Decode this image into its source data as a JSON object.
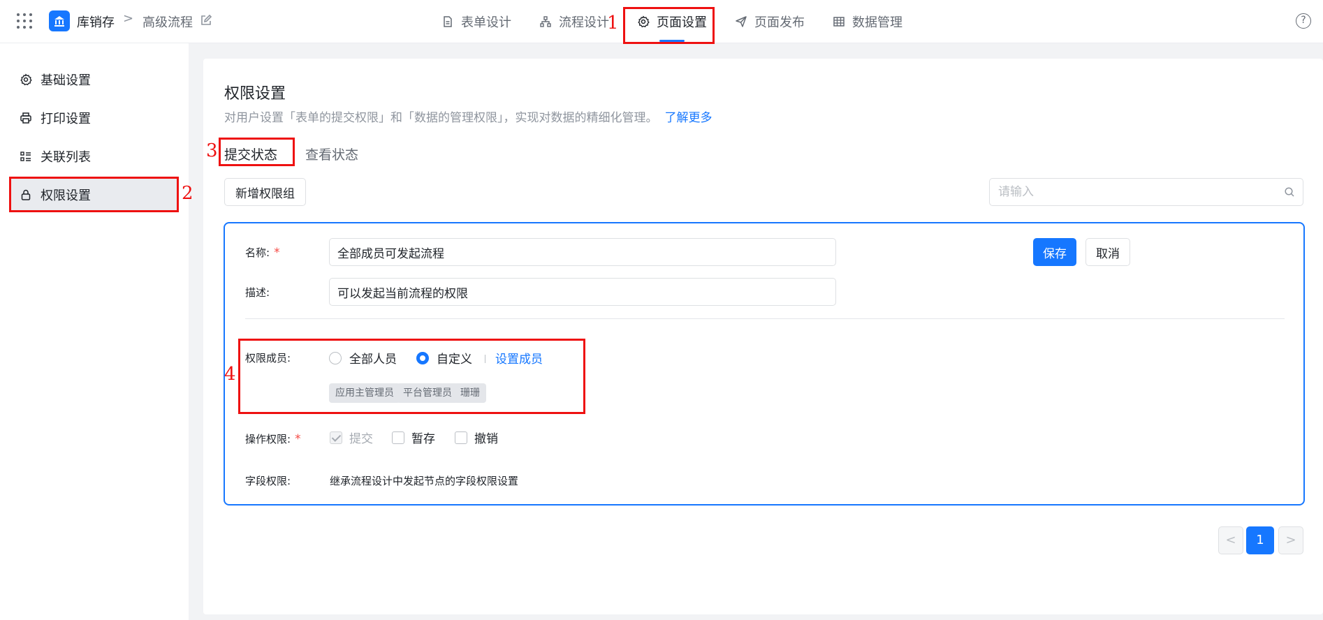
{
  "header": {
    "app_name": "库销存",
    "breadcrumb_separator": ">",
    "breadcrumb_current": "高级流程",
    "nav_tabs": [
      {
        "label": "表单设计",
        "icon": "document-icon"
      },
      {
        "label": "流程设计",
        "icon": "flow-icon"
      },
      {
        "label": "页面设置",
        "icon": "gear-icon",
        "active": true
      },
      {
        "label": "页面发布",
        "icon": "send-icon"
      },
      {
        "label": "数据管理",
        "icon": "table-icon"
      }
    ],
    "help": "?"
  },
  "sidebar": {
    "items": [
      {
        "label": "基础设置",
        "icon": "gear-icon"
      },
      {
        "label": "打印设置",
        "icon": "printer-icon"
      },
      {
        "label": "关联列表",
        "icon": "list-icon"
      },
      {
        "label": "权限设置",
        "icon": "lock-icon",
        "active": true
      }
    ]
  },
  "main": {
    "title": "权限设置",
    "description": "对用户设置「表单的提交权限」和「数据的管理权限」，实现对数据的精细化管理。",
    "learn_more": "了解更多",
    "tabs": [
      {
        "label": "提交状态",
        "active": true
      },
      {
        "label": "查看状态"
      }
    ],
    "add_group_label": "新增权限组",
    "search_placeholder": "请输入"
  },
  "permission_form": {
    "name_label": "名称:",
    "name_value": "全部成员可发起流程",
    "desc_label": "描述:",
    "desc_value": "可以发起当前流程的权限",
    "required_mark": "*",
    "save_label": "保存",
    "cancel_label": "取消",
    "members_label": "权限成员:",
    "member_options": [
      {
        "label": "全部人员",
        "selected": false
      },
      {
        "label": "自定义",
        "selected": true
      }
    ],
    "set_members_label": "设置成员",
    "member_tags": [
      "应用主管理员",
      "平台管理员",
      "珊珊"
    ],
    "operation_label": "操作权限:",
    "operations": [
      {
        "label": "提交",
        "checked": true,
        "disabled": true
      },
      {
        "label": "暂存",
        "checked": false
      },
      {
        "label": "撤销",
        "checked": false
      }
    ],
    "field_perm_label": "字段权限:",
    "field_perm_value": "继承流程设计中发起节点的字段权限设置"
  },
  "pagination": {
    "prev": "<",
    "current": "1",
    "next": ">"
  },
  "annotations": [
    "1",
    "2",
    "3",
    "4"
  ],
  "colors": {
    "accent": "#1677ff",
    "annotation": "#ee1111"
  }
}
